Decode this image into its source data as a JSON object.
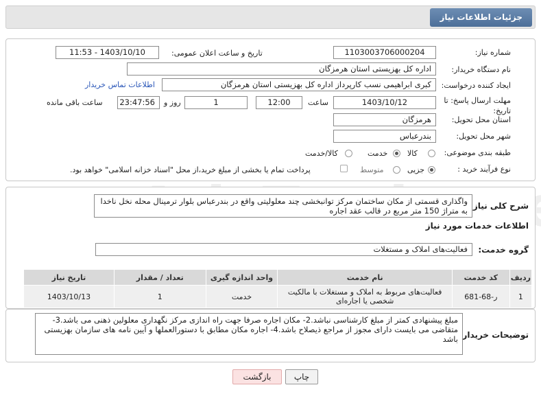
{
  "header": {
    "title": "جزئیات اطلاعات نیاز"
  },
  "form": {
    "need_number_label": "شماره نیاز:",
    "need_number": "1103003706000204",
    "announce_label": "تاریخ و ساعت اعلان عمومی:",
    "announce_value": "1403/10/10 - 11:53",
    "buyer_org_label": "نام دستگاه خریدار:",
    "buyer_org": "اداره کل بهزیستی استان هرمزگان",
    "creator_label": "ایجاد کننده درخواست:",
    "creator": "کبری  ابراهیمی نسب کارپرداز اداره کل بهزیستی استان هرمزگان",
    "contact_link": "اطلاعات تماس خریدار",
    "deadline_label": "مهلت ارسال پاسخ: تا تاریخ:",
    "deadline_date": "1403/10/12",
    "time_label": "ساعت",
    "deadline_time": "12:00",
    "days_value": "1",
    "days_label": "روز و",
    "remaining_time": "23:47:56",
    "remaining_label": "ساعت باقی مانده",
    "province_label": "استان محل تحویل:",
    "province": "هرمزگان",
    "city_label": "شهر محل تحویل:",
    "city": "بندرعباس",
    "category_label": "طبقه بندی موضوعی:",
    "category_options": [
      "کالا",
      "خدمت",
      "کالا/خدمت"
    ],
    "category_selected": "خدمت",
    "process_label": "نوع فرآیند خرید :",
    "process_options": [
      "جزیی",
      "متوسط"
    ],
    "process_selected": "جزیی",
    "payment_note": "پرداخت تمام یا بخشی از مبلغ خرید،از محل \"اسناد خزانه اسلامی\" خواهد بود."
  },
  "summary": {
    "label": "شرح کلی نیاز:",
    "text": "واگذاری قسمتی از مکان ساختمان مرکز توانبخشی چند معلولیتی واقع در بندرعباس بلوار ترمینال محله نخل ناخدا به متراژ 150 متر مربع  در قالب عقد اجاره"
  },
  "services": {
    "section_title": "اطلاعات خدمات مورد نیاز",
    "group_label": "گروه خدمت:",
    "group_value": "فعالیت‌های  املاک و مستغلات",
    "columns": [
      "ردیف",
      "کد خدمت",
      "نام خدمت",
      "واحد اندازه گیری",
      "تعداد / مقدار",
      "تاریخ نیاز"
    ],
    "rows": [
      [
        "1",
        "ر-68-681",
        "فعالیت‌های مربوط به املاک و مستغلات با مالکیت شخصی یا اجاره‌ای",
        "خدمت",
        "1",
        "1403/10/13"
      ]
    ]
  },
  "buyer_notes": {
    "label": "توضیحات خریدار:",
    "text": "مبلغ پیشنهادی کمتر از مبلغ کارشناسی نباشد.2- مکان اجاره صرفا جهت راه اندازی مرکز نگهداری معلولین ذهنی می باشد.3- متقاضی می بایست دارای مجوز از مراجع ذیصلاح باشد.4- اجاره مکان مطابق با دستورالعملها و آیین نامه های سازمان بهزیستی باشد"
  },
  "buttons": {
    "print": "چاپ",
    "back": "بازگشت"
  },
  "watermark": "AriaTender.neT",
  "colors": {
    "header_tab": "#5a7ba6",
    "link": "#2a56b8",
    "back_button": "#fbe2e2"
  }
}
